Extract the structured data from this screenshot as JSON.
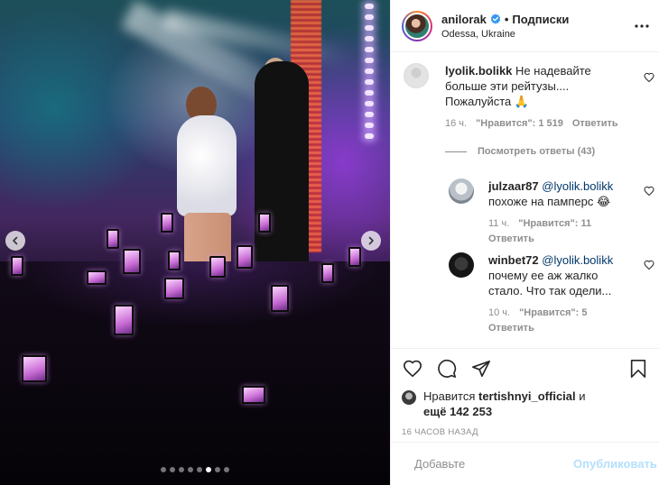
{
  "media": {
    "carousel_dots": 8,
    "active_dot": 6,
    "prev_icon": "chevron-left-icon",
    "next_icon": "chevron-right-icon"
  },
  "header": {
    "username": "anilorak",
    "separator": "•",
    "follow_label": "Подписки",
    "location": "Odessa, Ukraine",
    "verified_icon": "verified-badge-icon",
    "more_icon": "more-options-icon"
  },
  "comments": [
    {
      "username": "lyolik.bolikk",
      "text": "Не надевайте больше эти рейтузы.... Пожалуйста 🙏",
      "time": "16 ч.",
      "likes": "\"Нравится\": 1 519",
      "reply_label": "Ответить"
    }
  ],
  "view_replies": "Посмотреть ответы (43)",
  "replies": [
    {
      "username": "julzaar87",
      "mention": "@lyolik.bolikk",
      "text": "похоже на памперс 😂",
      "time": "11 ч.",
      "likes": "\"Нравится\": 11",
      "reply_label": "Ответить"
    },
    {
      "username": "winbet72",
      "mention": "@lyolik.bolikk",
      "text": "почему ее аж жалко стало. Что так одели...",
      "time": "10 ч.",
      "likes": "\"Нравится\": 5",
      "reply_label": "Ответить"
    }
  ],
  "actions": {
    "like_icon": "heart-icon",
    "comment_icon": "comment-icon",
    "share_icon": "send-icon",
    "save_icon": "bookmark-icon"
  },
  "likes": {
    "prefix": "Нравится",
    "user": "tertishnyi_official",
    "conj": "и",
    "more_prefix": "ещё",
    "count": "142 253"
  },
  "timestamp": "16 ЧАСОВ НАЗАД",
  "composer": {
    "placeholder": "Добавьте",
    "publish_label": "Опубликовать",
    "emoji_icon": "emoji-icon"
  },
  "colors": {
    "link": "#00376b",
    "muted": "#8e8e8e",
    "publish_disabled": "#b2dffc"
  }
}
